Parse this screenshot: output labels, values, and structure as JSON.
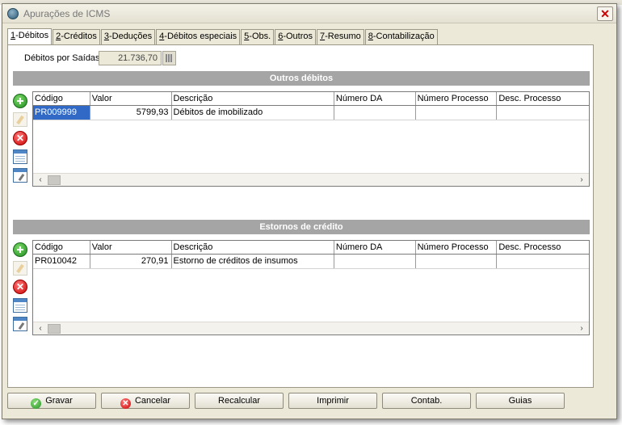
{
  "window": {
    "title": "Apurações de ICMS"
  },
  "tabs": [
    {
      "key": "1",
      "label": "-Débitos",
      "active": true
    },
    {
      "key": "2",
      "label": "-Créditos"
    },
    {
      "key": "3",
      "label": "-Deduções"
    },
    {
      "key": "4",
      "label": "-Débitos especiais"
    },
    {
      "key": "5",
      "label": "-Obs."
    },
    {
      "key": "6",
      "label": "-Outros"
    },
    {
      "key": "7",
      "label": "-Resumo"
    },
    {
      "key": "8",
      "label": "-Contabilização"
    }
  ],
  "debitos_saidas": {
    "label": "Débitos por Saídas",
    "value": "21.736,70"
  },
  "columns": [
    "Código",
    "Valor",
    "Descrição",
    "Número DA",
    "Número Processo",
    "Desc. Processo"
  ],
  "outros_debitos": {
    "title": "Outros débitos",
    "rows": [
      {
        "codigo": "PR009999",
        "valor": "5799,93",
        "descricao": "Débitos de imobilizado",
        "numero_da": "",
        "numero_processo": "",
        "desc_processo": ""
      }
    ]
  },
  "estornos_credito": {
    "title": "Estornos de crédito",
    "rows": [
      {
        "codigo": "PR010042",
        "valor": "270,91",
        "descricao": "Estorno de créditos de insumos",
        "numero_da": "",
        "numero_processo": "",
        "desc_processo": ""
      }
    ]
  },
  "footer": {
    "gravar": "Gravar",
    "cancelar": "Cancelar",
    "recalcular": "Recalcular",
    "imprimir": "Imprimir",
    "contab": "Contab.",
    "guias": "Guias"
  },
  "icons": {
    "close": "close-icon",
    "add": "add-icon",
    "edit": "edit-icon",
    "delete": "delete-icon",
    "grid": "grid-view-icon",
    "form": "form-edit-icon"
  }
}
